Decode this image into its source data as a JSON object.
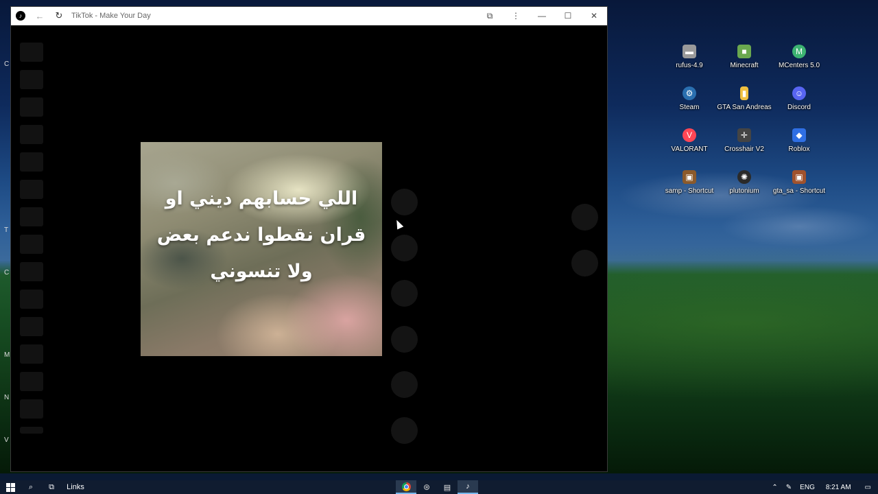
{
  "window": {
    "title": "TikTok - Make Your Day",
    "icons": {
      "app": "tiktok-icon",
      "back": "back-arrow-icon",
      "reload": "reload-icon",
      "extensions": "puzzle-icon",
      "menu": "kebab-menu-icon",
      "minimize": "minimize-icon",
      "maximize": "maximize-icon",
      "close": "close-icon"
    }
  },
  "video": {
    "caption": "اللي حسابهم ديني او قران نقطوا ندعم بعض ولا تنسوني"
  },
  "desktop": {
    "icons": [
      {
        "label": "rufus-4.9",
        "icon": "usb-drive-icon",
        "color": "#c8c8c8"
      },
      {
        "label": "Minecraft",
        "icon": "grass-block-icon",
        "color": "#6aa84f"
      },
      {
        "label": "MCenters 5.0",
        "icon": "mcenters-icon",
        "color": "#3cb371"
      },
      {
        "label": "Steam",
        "icon": "steam-icon",
        "color": "#2a6fb0"
      },
      {
        "label": "GTA San Andreas",
        "icon": "folder-icon",
        "color": "#f0c040"
      },
      {
        "label": "Discord",
        "icon": "discord-icon",
        "color": "#5865f2"
      },
      {
        "label": "VALORANT",
        "icon": "valorant-icon",
        "color": "#ff4655"
      },
      {
        "label": "Crosshair V2",
        "icon": "crosshair-icon",
        "color": "#444444"
      },
      {
        "label": "Roblox",
        "icon": "roblox-icon",
        "color": "#2f6fe4"
      },
      {
        "label": "samp - Shortcut",
        "icon": "samp-icon",
        "color": "#8b5a2b"
      },
      {
        "label": "plutonium",
        "icon": "plutonium-icon",
        "color": "#2a2a2a"
      },
      {
        "label": "gta_sa - Shortcut",
        "icon": "gta-icon",
        "color": "#a0522d"
      }
    ]
  },
  "taskbar": {
    "links_label": "Links",
    "language": "ENG",
    "time": "8:21 AM",
    "icons": {
      "start": "windows-start-icon",
      "search": "search-icon",
      "task_view": "task-view-icon",
      "chrome": "chrome-icon",
      "steam": "steam-icon",
      "files": "file-explorer-icon",
      "tiktok": "tiktok-icon",
      "tray_up": "chevron-up-icon",
      "network": "network-icon",
      "notifications": "notification-icon"
    }
  }
}
